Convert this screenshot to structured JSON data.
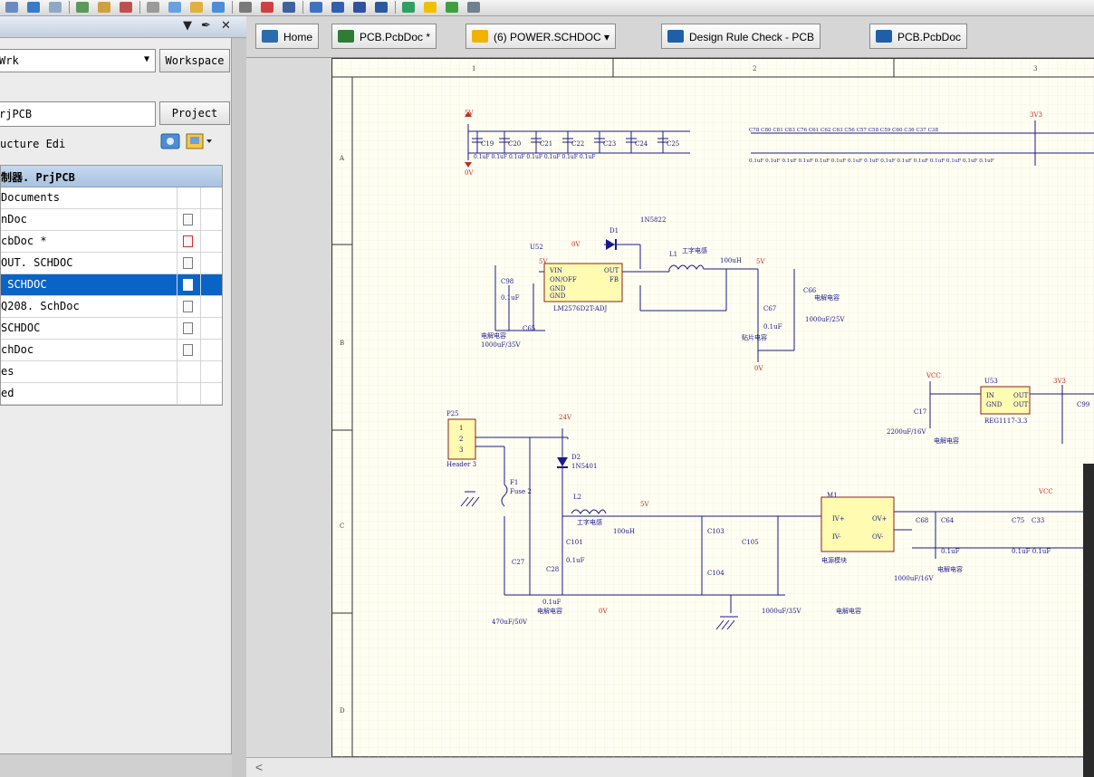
{
  "toolbar": {
    "icons": [
      "folder-icon",
      "globe-icon",
      "search-icon",
      "zoom-icon",
      "undo-icon",
      "redo-icon",
      "cut-icon",
      "copy-icon",
      "paste-icon",
      "select-icon",
      "move-icon",
      "cross-icon",
      "wire-icon",
      "bus-icon",
      "port-icon",
      "power-icon",
      "net-label-icon",
      "component-icon",
      "arrow-up-icon",
      "arrow-down-icon",
      "gear-icon"
    ]
  },
  "panel": {
    "header_controls": [
      "▼",
      "✒",
      "✕"
    ],
    "workspace_value": "Wrk",
    "workspace_button": "Workspace",
    "project_value": "rjPCB",
    "project_button": "Project",
    "structure_label": "ucture Edi",
    "tree_title": "制器. PrjPCB",
    "tree_rows": [
      {
        "label": "Documents",
        "icon": "",
        "selected": false
      },
      {
        "label": "nDoc",
        "icon": "doc",
        "selected": false
      },
      {
        "label": "cbDoc *",
        "icon": "doc-red",
        "selected": false
      },
      {
        "label": "OUT. SCHDOC",
        "icon": "doc",
        "selected": false
      },
      {
        "label": " SCHDOC",
        "icon": "doc",
        "selected": true
      },
      {
        "label": "Q208. SchDoc",
        "icon": "doc",
        "selected": false
      },
      {
        "label": "SCHDOC",
        "icon": "doc",
        "selected": false
      },
      {
        "label": "chDoc",
        "icon": "doc",
        "selected": false
      },
      {
        "label": "es",
        "icon": "",
        "selected": false
      },
      {
        "label": "ed",
        "icon": "",
        "selected": false
      }
    ]
  },
  "tabs": [
    {
      "label": "Home",
      "icon": "home-icon",
      "color": "#2b6cb0"
    },
    {
      "label": "PCB.PcbDoc *",
      "icon": "pcb-icon",
      "color": "#2e7d32"
    },
    {
      "label": "(6) POWER.SCHDOC  ▾",
      "icon": "schematic-icon",
      "color": "#f0b400"
    },
    {
      "label": "Design Rule Check - PCB",
      "icon": "globe-icon",
      "color": "#1e5fa8"
    },
    {
      "label": "PCB.PcbDoc",
      "icon": "globe-icon",
      "color": "#1e5fa8"
    }
  ],
  "sheet": {
    "col_labels": [
      "1",
      "2",
      "3"
    ],
    "row_labels": [
      "A",
      "B",
      "C",
      "D"
    ],
    "texts": {
      "v5_top": "5V",
      "v3v3_top": "3V3",
      "zero_v": "0V",
      "c19": "C19",
      "c20": "C20",
      "c21": "C21",
      "c22": "C22",
      "c23": "C23",
      "c24": "C24",
      "c25": "C25",
      "cap_top_vals": "0.1uF  0.1uF  0.1uF  0.1uF  0.1uF  0.1uF  0.1uF",
      "cap_row_labels": "C78  C80  C81  C83  C76   C61  C62  C63  C56  C57  C58  C59  C60    C36  C37  C38",
      "cap_row_vals": "0.1uF 0.1uF 0.1uF 0.1uF 0.1uF    0.1uF 0.1uF 0.1uF 0.1uF 0.1uF 0.1uF 0.1uF 0.1uF       0.1uF   0.1uF",
      "d1": "D1",
      "in5822": "1N5822",
      "u52": "U52",
      "lm": "LM2576D2T-ADJ",
      "l1": "L1",
      "l1_desc": "工字电感",
      "l1_val": "100uH",
      "c66": "C66",
      "c66_desc": "电解电容",
      "c67": "C67",
      "c67_val": "0.1uF",
      "c66_val": "1000uF/25V",
      "smd_cap": "贴片电容",
      "c98": "C98",
      "c98_val": "0.1uF",
      "c65": "C65",
      "elec_cap": "电解电容",
      "c65_val": "1000uF/35V",
      "vin": "VIN",
      "out": "OUT",
      "onoff": "ON/OFF",
      "fb": "FB",
      "gnd": "GND",
      "vcc": "VCC",
      "u53": "U53",
      "reg": "REG1117-3.3",
      "c17": "C17",
      "c17_val": "2200uF/16V",
      "in_lbl": "IN",
      "out_lbl": "OUT",
      "gnd_lbl": "GND",
      "p25": "P25",
      "header3": "Header 3",
      "v24": "24V",
      "d2": "D2",
      "in5401": "1N5401",
      "f1": "F1",
      "fuse2": "Fuse 2",
      "l2": "L2",
      "l2_desc": "工字电感",
      "l2_val": "100uH",
      "c101": "C101",
      "c101_val": "0.1uF",
      "c27": "C27",
      "c28": "C28",
      "c28_val": "0.1uF",
      "c27_val": "470uF/50V",
      "elec_cap2": "电解电容",
      "c103": "C103",
      "c104": "C104",
      "c105": "C105",
      "c105_val": "1000uF/35V",
      "elec_cap3": "电解电容",
      "m1": "M1",
      "m1_inp": "IV+",
      "m1_inn": "IV-",
      "m1_outp": "OV+",
      "m1_outn": "OV-",
      "m1_desc": "电源模块",
      "c68": "C68",
      "c64": "C64",
      "c64_val": "0.1uF",
      "c68_val": "1000uF/16V",
      "c68_desc": "电解电容",
      "c75": "C75",
      "c33": "C33",
      "c75_val": "0.1uF  0.1uF",
      "c99": "C99",
      "vcc2": "VCC"
    }
  }
}
